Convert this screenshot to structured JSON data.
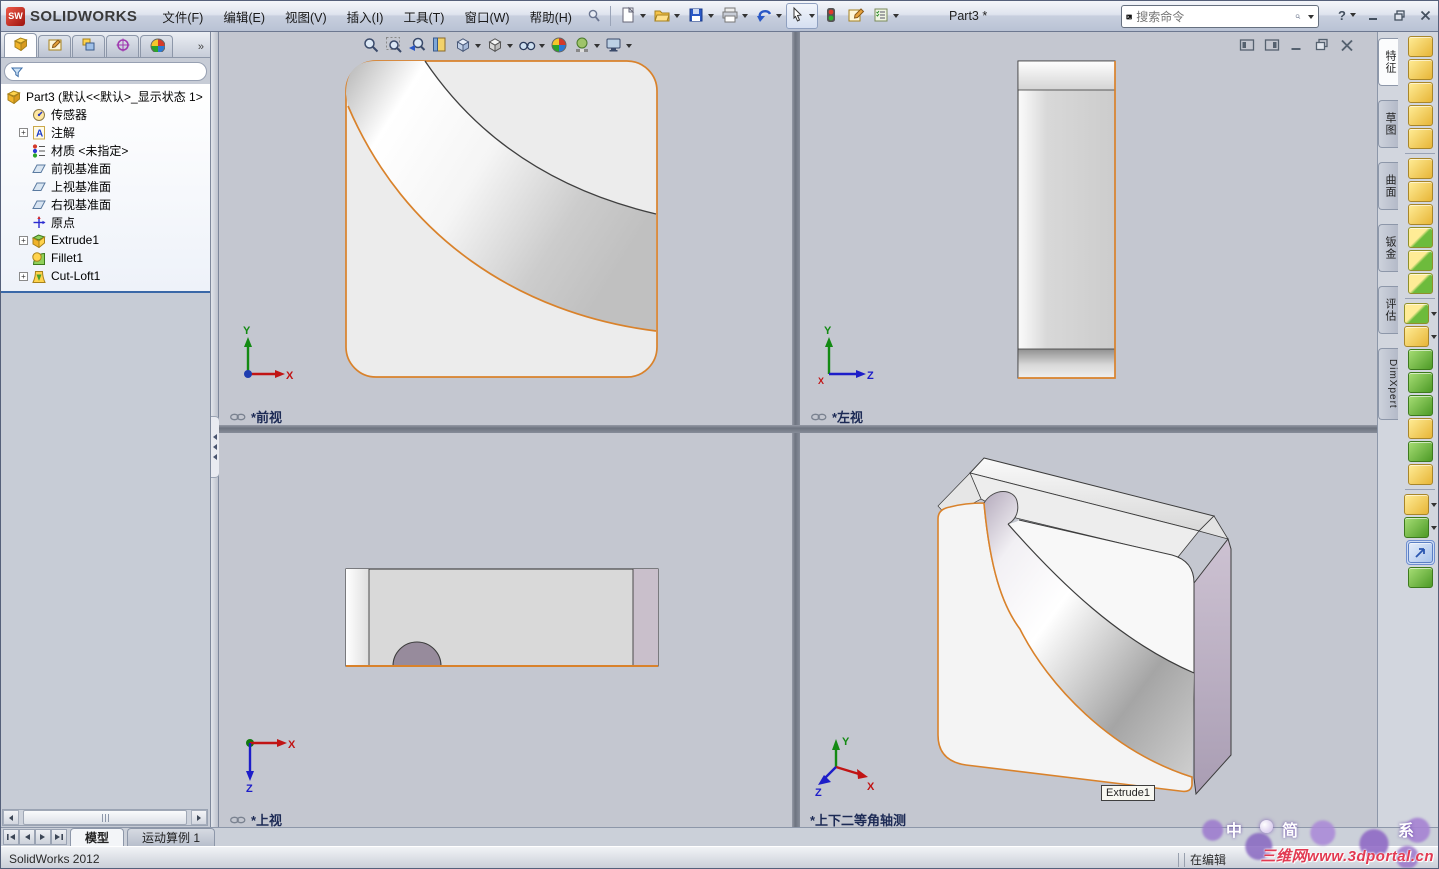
{
  "window": {
    "app": "SOLIDWORKS",
    "title": "Part3 *",
    "help_label": "?"
  },
  "menu": {
    "items": [
      "文件(F)",
      "编辑(E)",
      "视图(V)",
      "插入(I)",
      "工具(T)",
      "窗口(W)",
      "帮助(H)"
    ]
  },
  "quick_toolbar": [
    {
      "name": "new-document",
      "dropdown": true
    },
    {
      "name": "open",
      "dropdown": true
    },
    {
      "name": "save",
      "dropdown": true
    },
    {
      "name": "print",
      "dropdown": true
    },
    {
      "name": "undo",
      "dropdown": true
    },
    {
      "name": "select",
      "dropdown": true,
      "grouped": true
    },
    {
      "name": "rebuild",
      "dropdown": false
    },
    {
      "name": "options",
      "dropdown": false
    },
    {
      "name": "task-list",
      "dropdown": true
    }
  ],
  "search": {
    "placeholder": "搜索命令"
  },
  "left_panel": {
    "tabs": [
      {
        "name": "feature-manager",
        "active": true
      },
      {
        "name": "property-manager",
        "active": false
      },
      {
        "name": "configuration-manager",
        "active": false
      },
      {
        "name": "dimxpert-manager",
        "active": false
      },
      {
        "name": "display-manager",
        "active": false
      }
    ],
    "overflow_chevron": "»",
    "tree": [
      {
        "label": "Part3 (默认<<默认>_显示状态 1>",
        "icon": "part",
        "expand": null,
        "root": true
      },
      {
        "label": "传感器",
        "icon": "sensors",
        "expand": null
      },
      {
        "label": "注解",
        "icon": "annotations",
        "expand": "+"
      },
      {
        "label": "材质 <未指定>",
        "icon": "material",
        "expand": null
      },
      {
        "label": "前视基准面",
        "icon": "plane",
        "expand": null
      },
      {
        "label": "上视基准面",
        "icon": "plane",
        "expand": null
      },
      {
        "label": "右视基准面",
        "icon": "plane",
        "expand": null
      },
      {
        "label": "原点",
        "icon": "origin",
        "expand": null
      },
      {
        "label": "Extrude1",
        "icon": "extrude",
        "expand": "+"
      },
      {
        "label": "Fillet1",
        "icon": "fillet",
        "expand": null
      },
      {
        "label": "Cut-Loft1",
        "icon": "cut-loft",
        "expand": "+"
      }
    ]
  },
  "hud": {
    "icons": [
      {
        "name": "zoom-fit",
        "dropdown": false
      },
      {
        "name": "zoom-area",
        "dropdown": false
      },
      {
        "name": "previous-view",
        "dropdown": false
      },
      {
        "name": "section-view",
        "dropdown": false
      },
      {
        "name": "view-orientation",
        "dropdown": true
      },
      {
        "name": "display-style",
        "dropdown": true
      },
      {
        "name": "hide-show-items",
        "dropdown": true
      },
      {
        "name": "edit-appearance",
        "dropdown": false
      },
      {
        "name": "apply-scene",
        "dropdown": true
      },
      {
        "name": "view-settings",
        "dropdown": true
      }
    ]
  },
  "doc_controls": [
    {
      "name": "pane-left"
    },
    {
      "name": "pane-right"
    },
    {
      "name": "minimize"
    },
    {
      "name": "restore"
    },
    {
      "name": "close"
    }
  ],
  "viewports": {
    "front": {
      "label": "*前视",
      "linked": true,
      "axes": {
        "x": "X",
        "y": "Y"
      }
    },
    "left": {
      "label": "*左视",
      "linked": true,
      "axes": {
        "x": "X",
        "y": "Y",
        "z": "Z"
      }
    },
    "top": {
      "label": "*上视",
      "linked": true,
      "axes": {
        "x": "X",
        "z": "Z"
      }
    },
    "iso": {
      "label": "*上下二等角轴测",
      "linked": false,
      "axes": {
        "x": "X",
        "y": "Y",
        "z": "Z"
      },
      "tooltip": "Extrude1"
    }
  },
  "right_toolbar": {
    "tabs": [
      {
        "label": "特征",
        "active": true
      },
      {
        "label": "草图",
        "active": false
      },
      {
        "label": "曲面",
        "active": false
      },
      {
        "label": "钣金",
        "active": false
      },
      {
        "label": "评估",
        "active": false
      },
      {
        "label": "DimXpert",
        "active": false
      }
    ],
    "icons": [
      {
        "name": "extruded-boss",
        "c": "cy"
      },
      {
        "name": "revolved-boss",
        "c": "cy"
      },
      {
        "name": "swept-boss",
        "c": "cy"
      },
      {
        "name": "lofted-boss",
        "c": "cy"
      },
      {
        "name": "boundary-boss",
        "c": "cy"
      },
      {
        "sep": true
      },
      {
        "name": "extruded-cut",
        "c": "cy"
      },
      {
        "name": "hole-wizard",
        "c": "cy"
      },
      {
        "name": "revolved-cut",
        "c": "cy"
      },
      {
        "name": "swept-cut",
        "c": "cyg"
      },
      {
        "name": "lofted-cut",
        "c": "cyg"
      },
      {
        "name": "boundary-cut",
        "c": "cyg"
      },
      {
        "sep": true
      },
      {
        "name": "fillet",
        "c": "cyg",
        "dd": true
      },
      {
        "name": "linear-pattern",
        "c": "cy",
        "dd": true
      },
      {
        "name": "rib",
        "c": "cg"
      },
      {
        "name": "draft",
        "c": "cg"
      },
      {
        "name": "shell",
        "c": "cg"
      },
      {
        "name": "wrap",
        "c": "cy"
      },
      {
        "name": "dome",
        "c": "cg"
      },
      {
        "name": "mirror",
        "c": "cy"
      },
      {
        "sep": true
      },
      {
        "name": "reference-geometry",
        "c": "cy",
        "dd": true
      },
      {
        "name": "curves",
        "c": "cg",
        "dd": true
      },
      {
        "name": "instant3d",
        "c": "cb",
        "active": true
      },
      {
        "name": "combine",
        "c": "cg"
      }
    ]
  },
  "bottom_bar": {
    "tabs": [
      {
        "label": "模型",
        "active": true
      },
      {
        "label": "运动算例 1",
        "active": false
      }
    ]
  },
  "status_bar": {
    "left": "SolidWorks 2012",
    "right": "在编辑"
  },
  "watermark": {
    "c1": "中",
    "c2": "简",
    "c3": "系",
    "site": "三维网www.3dportal.cn"
  },
  "colors": {
    "edge_highlight_orange": "#d9822b",
    "viewport_background": "#c4c7d0",
    "axis_x": "#c11414",
    "axis_y": "#138a13",
    "axis_z": "#1d1dc9",
    "tree_divider_blue": "#3a68a8"
  }
}
